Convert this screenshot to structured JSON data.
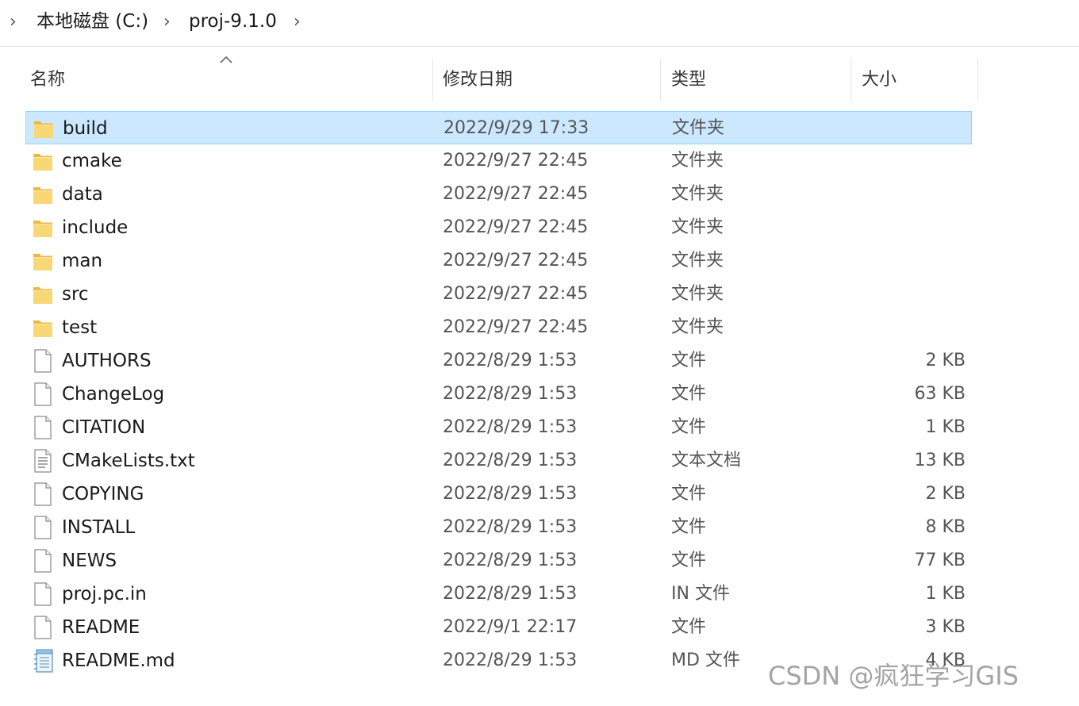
{
  "breadcrumb": {
    "items": [
      "本地磁盘 (C:)",
      "proj-9.1.0"
    ]
  },
  "columns": {
    "name": "名称",
    "modified": "修改日期",
    "type": "类型",
    "size": "大小"
  },
  "files": [
    {
      "name": "build",
      "date": "2022/9/29 17:33",
      "type": "文件夹",
      "size": "",
      "icon": "folder-icon",
      "selected": true
    },
    {
      "name": "cmake",
      "date": "2022/9/27 22:45",
      "type": "文件夹",
      "size": "",
      "icon": "folder-icon"
    },
    {
      "name": "data",
      "date": "2022/9/27 22:45",
      "type": "文件夹",
      "size": "",
      "icon": "folder-icon"
    },
    {
      "name": "include",
      "date": "2022/9/27 22:45",
      "type": "文件夹",
      "size": "",
      "icon": "folder-icon"
    },
    {
      "name": "man",
      "date": "2022/9/27 22:45",
      "type": "文件夹",
      "size": "",
      "icon": "folder-icon"
    },
    {
      "name": "src",
      "date": "2022/9/27 22:45",
      "type": "文件夹",
      "size": "",
      "icon": "folder-icon"
    },
    {
      "name": "test",
      "date": "2022/9/27 22:45",
      "type": "文件夹",
      "size": "",
      "icon": "folder-icon"
    },
    {
      "name": "AUTHORS",
      "date": "2022/8/29 1:53",
      "type": "文件",
      "size": "2 KB",
      "icon": "file-icon"
    },
    {
      "name": "ChangeLog",
      "date": "2022/8/29 1:53",
      "type": "文件",
      "size": "63 KB",
      "icon": "file-icon"
    },
    {
      "name": "CITATION",
      "date": "2022/8/29 1:53",
      "type": "文件",
      "size": "1 KB",
      "icon": "file-icon"
    },
    {
      "name": "CMakeLists.txt",
      "date": "2022/8/29 1:53",
      "type": "文本文档",
      "size": "13 KB",
      "icon": "text-file-icon"
    },
    {
      "name": "COPYING",
      "date": "2022/8/29 1:53",
      "type": "文件",
      "size": "2 KB",
      "icon": "file-icon"
    },
    {
      "name": "INSTALL",
      "date": "2022/8/29 1:53",
      "type": "文件",
      "size": "8 KB",
      "icon": "file-icon"
    },
    {
      "name": "NEWS",
      "date": "2022/8/29 1:53",
      "type": "文件",
      "size": "77 KB",
      "icon": "file-icon"
    },
    {
      "name": "proj.pc.in",
      "date": "2022/8/29 1:53",
      "type": "IN 文件",
      "size": "1 KB",
      "icon": "file-icon"
    },
    {
      "name": "README",
      "date": "2022/9/1 22:17",
      "type": "文件",
      "size": "3 KB",
      "icon": "file-icon"
    },
    {
      "name": "README.md",
      "date": "2022/8/29 1:53",
      "type": "MD 文件",
      "size": "4 KB",
      "icon": "notepad-file-icon"
    }
  ],
  "watermark": "CSDN @疯狂学习GIS",
  "colors": {
    "selection_bg": "#cce8ff",
    "selection_border": "#99d1ff",
    "folder_yellow": "#f8d775"
  }
}
